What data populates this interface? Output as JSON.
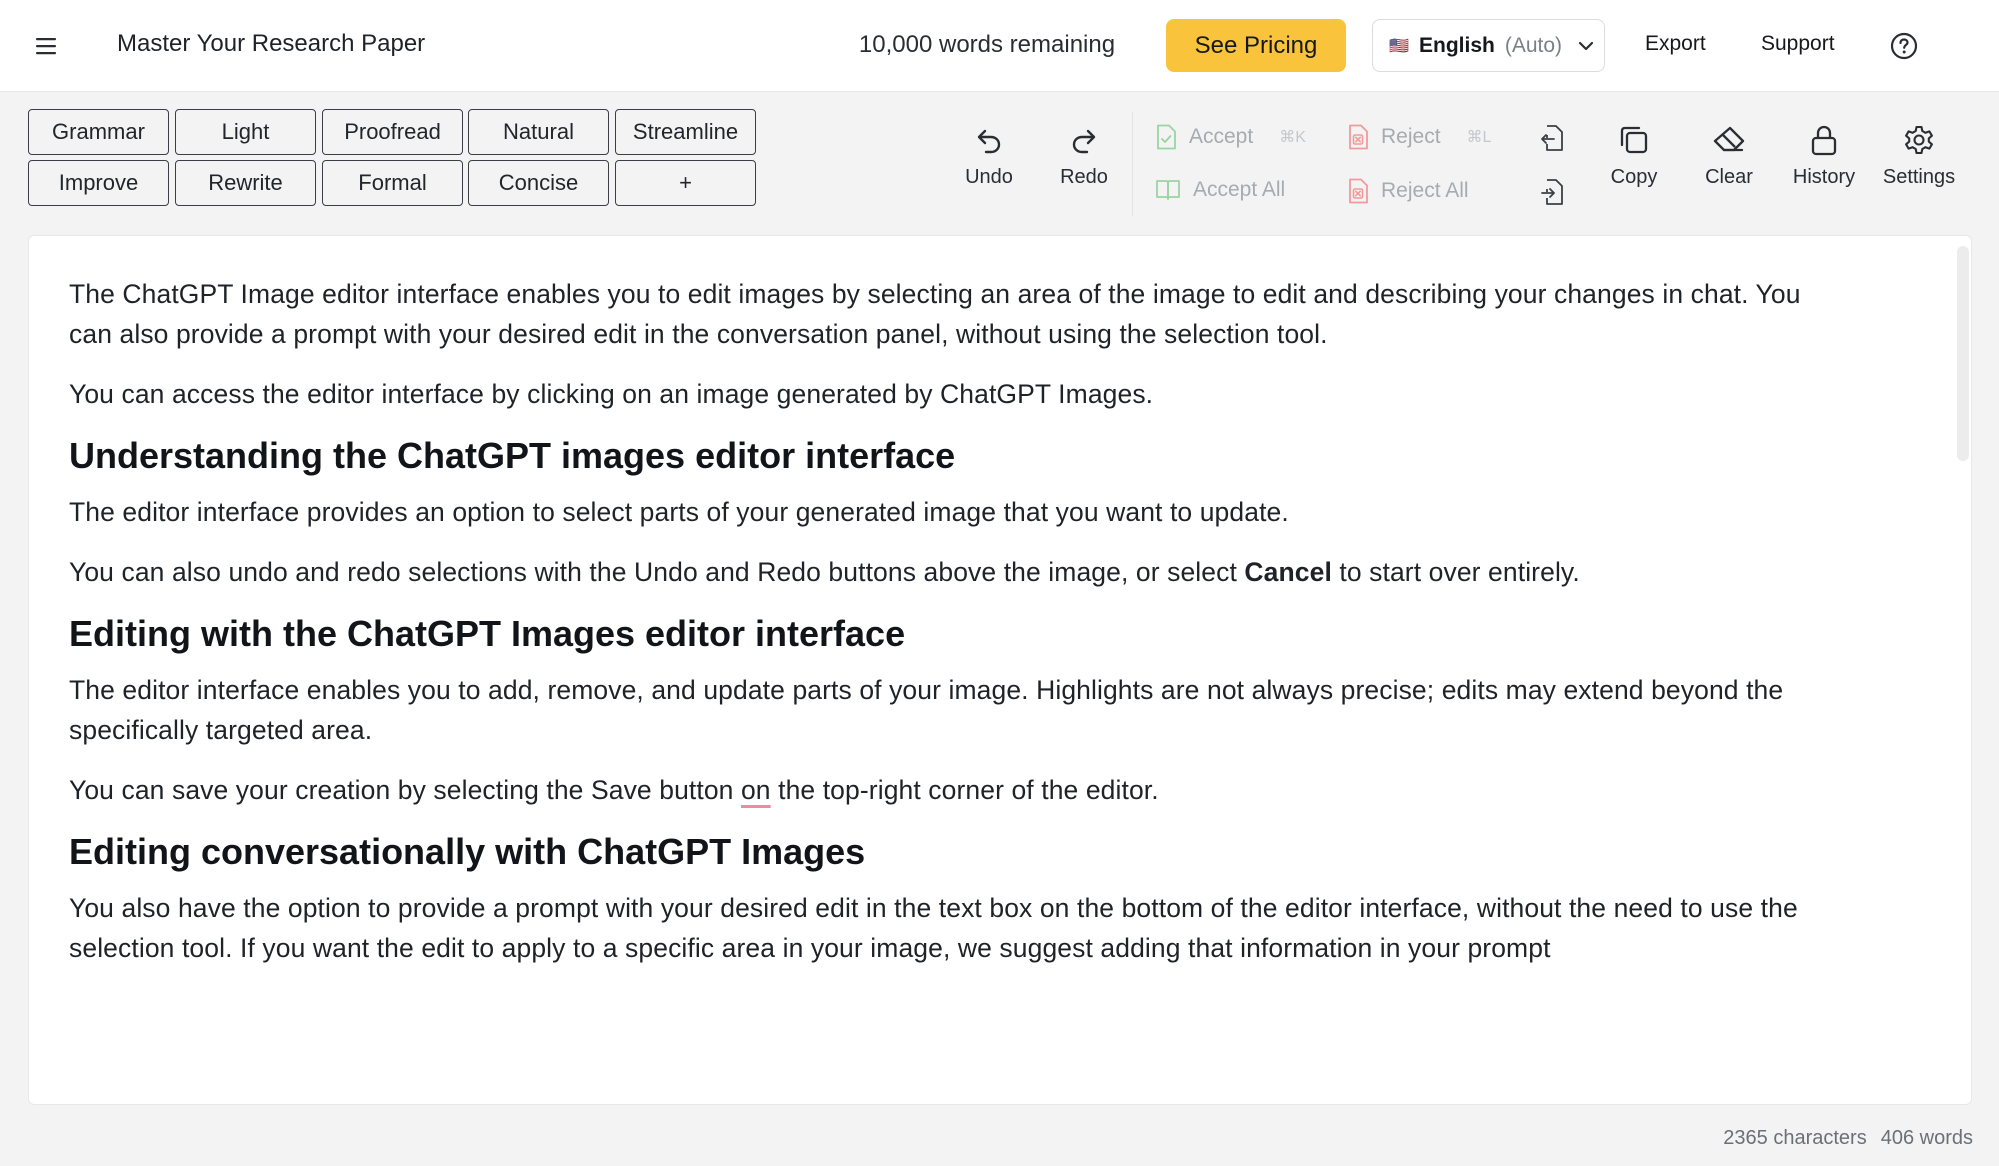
{
  "header": {
    "title": "Master Your Research Paper",
    "words_remaining": "10,000 words remaining",
    "pricing_label": "See Pricing",
    "language": {
      "flag": "🇺🇸",
      "name": "English",
      "mode": "(Auto)"
    },
    "export_label": "Export",
    "support_label": "Support"
  },
  "style_buttons": {
    "row1": [
      "Grammar",
      "Light",
      "Proofread",
      "Natural",
      "Streamline"
    ],
    "row2": [
      "Improve",
      "Rewrite",
      "Formal",
      "Concise",
      "+"
    ]
  },
  "tools": {
    "undo": "Undo",
    "redo": "Redo",
    "accept": "Accept",
    "accept_shortcut": "⌘K",
    "accept_all": "Accept All",
    "reject": "Reject",
    "reject_shortcut": "⌘L",
    "reject_all": "Reject All",
    "copy": "Copy",
    "clear": "Clear",
    "history": "History",
    "settings": "Settings"
  },
  "document": {
    "p1": "The ChatGPT Image editor interface enables you to edit images by selecting an area of the image to edit and describing your changes in chat. You can also provide a prompt with your desired edit in the conversation panel, without using the selection tool.",
    "p2": "You can access the editor interface by clicking on an image generated by ChatGPT Images.",
    "h1": "Understanding the ChatGPT images editor interface",
    "p3": "The editor interface provides an option to select parts of your generated image that you want to update.",
    "p4_before": "You can also undo and redo selections with the Undo and Redo buttons above the image, or select ",
    "p4_bold": "Cancel",
    "p4_after": " to start over entirely.",
    "h2": "Editing with the ChatGPT Images editor interface",
    "p5": "The editor interface enables you to add, remove, and update parts of your image. Highlights are not always precise; edits may extend beyond the specifically targeted area.",
    "p6_before": "You can save your creation by selecting the Save button ",
    "p6_flag": "on",
    "p6_after": " the top-right corner of the editor.",
    "h3": "Editing conversationally with ChatGPT Images",
    "p7": "You also have the option to provide a prompt with your desired edit in the text box on the bottom of the editor interface, without the need to use the selection tool. If you want the edit to apply to a specific area in your image, we suggest adding that information in your prompt"
  },
  "status": {
    "characters": "2365 characters",
    "words": "406 words"
  },
  "colors": {
    "accent": "#f9c33b",
    "accept_green": "#8fd29a",
    "reject_red": "#f08b8b"
  },
  "icons": {
    "menu": "hamburger-icon",
    "chevron": "chevron-down-icon",
    "help": "question-circle-icon",
    "undo": "undo-icon",
    "redo": "redo-icon",
    "copy": "copy-icon",
    "clear": "eraser-icon",
    "history": "lock-icon",
    "settings": "gear-icon"
  }
}
